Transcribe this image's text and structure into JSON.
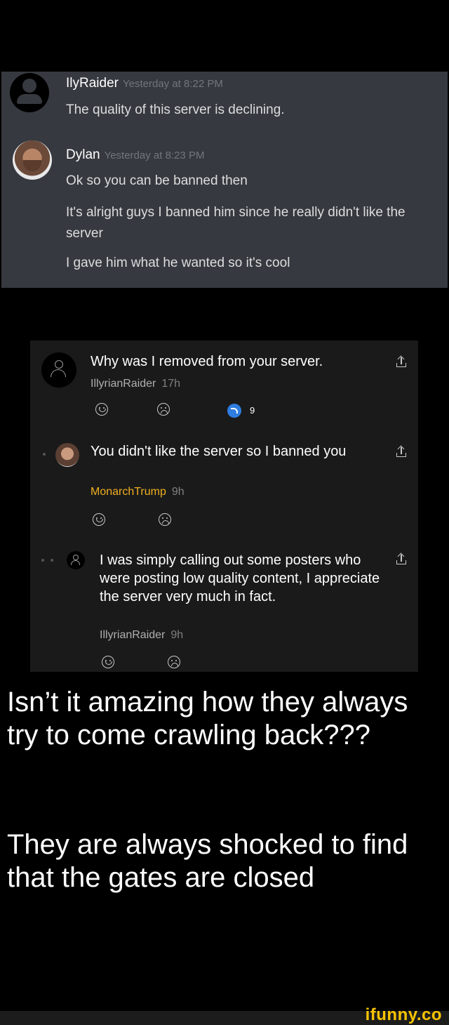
{
  "discord": {
    "messages": [
      {
        "username": "IlyRaider",
        "timestamp": "Yesterday at 8:22 PM",
        "lines": [
          "The quality of this server is declining."
        ]
      },
      {
        "username": "Dylan",
        "timestamp": "Yesterday at 8:23 PM",
        "lines": [
          "Ok so you can be banned then",
          "It's alright guys I banned him since he really didn't like the server",
          "I gave him what he wanted so it's cool"
        ]
      }
    ]
  },
  "reddit": {
    "comments": [
      {
        "text": "Why was I removed from your server.",
        "username": "IllyrianRaider",
        "age": "17h",
        "reply_count": "9"
      },
      {
        "text": "You didn't like the server so I banned you",
        "username": "MonarchTrump",
        "age": "9h"
      },
      {
        "text": "I was simply calling out some posters who were posting low quality content, I appreciate the server very much in fact.",
        "username": "IllyrianRaider",
        "age": "9h"
      }
    ]
  },
  "caption": {
    "paragraph1": "Isn’t it amazing how they always try to come crawling back???",
    "paragraph2": "They are always shocked to find that the gates are closed"
  },
  "watermark": "ifunny.co",
  "colors": {
    "discord_bg": "#36393f",
    "reddit_bg": "#1a1a1b",
    "gold_user": "#f0b01f",
    "reply_badge": "#2f7de1",
    "watermark": "#f7c300"
  }
}
